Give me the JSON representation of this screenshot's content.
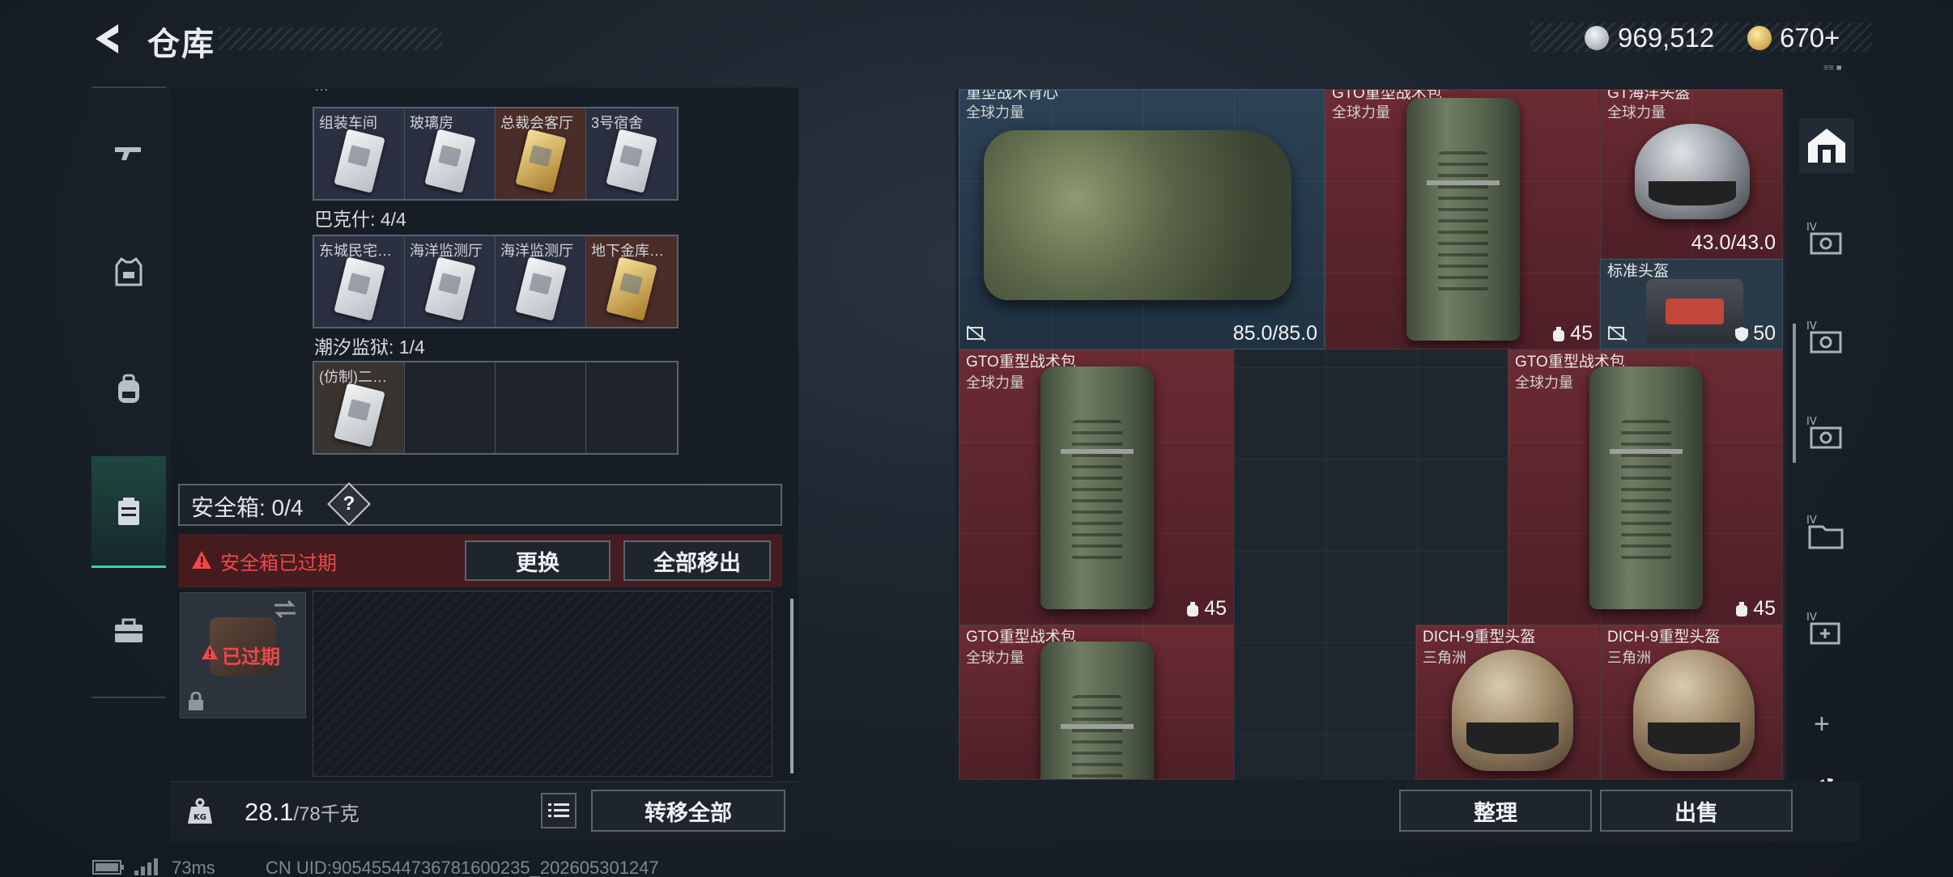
{
  "header": {
    "title": "仓库",
    "currency_silver": "969,512",
    "currency_gold": "670+",
    "usage_hint": "≡≡ ■"
  },
  "left_nav": {
    "items": [
      {
        "name": "weapons",
        "icon": "gun-icon"
      },
      {
        "name": "armor",
        "icon": "armor-vest-icon"
      },
      {
        "name": "backpack",
        "icon": "backpack-icon"
      },
      {
        "name": "container",
        "icon": "container-icon",
        "active": true
      },
      {
        "name": "toolbox",
        "icon": "toolbox-icon"
      }
    ]
  },
  "keys": {
    "top_label_partial": "…",
    "row1": [
      {
        "name": "组装车间",
        "rarity": "white"
      },
      {
        "name": "玻璃房",
        "rarity": "white"
      },
      {
        "name": "总裁会客厅",
        "rarity": "gold"
      },
      {
        "name": "3号宿舍",
        "rarity": "white"
      }
    ],
    "group2_label": "巴克什: 4/4",
    "row2": [
      {
        "name": "东城民宅…",
        "rarity": "white"
      },
      {
        "name": "海洋监测厅",
        "rarity": "white"
      },
      {
        "name": "海洋监测厅",
        "rarity": "white"
      },
      {
        "name": "地下金库…",
        "rarity": "gold"
      }
    ],
    "group3_label": "潮汐监狱: 1/4",
    "row3": [
      {
        "name": "(仿制)二…",
        "rarity": "white"
      }
    ]
  },
  "safebox": {
    "title": "安全箱: 0/4",
    "help": "?",
    "expired_warning": "安全箱已过期",
    "replace_button": "更换",
    "move_all_button": "全部移出",
    "item_expired_label": "已过期"
  },
  "weight": {
    "current": "28.1",
    "max": "/78千克",
    "transfer_all_button": "转移全部",
    "kg_label": "KG"
  },
  "stash_items": [
    {
      "id": "vest",
      "name": "重型战术背心",
      "sub": "全球力量",
      "value": "85.0/85.0"
    },
    {
      "id": "pack-top",
      "name": "GTO重型战术包",
      "sub": "全球力量",
      "capacity": "45"
    },
    {
      "id": "helmet-top",
      "name": "GT海洋头盔",
      "sub": "全球力量",
      "value": "43.0/43.0"
    },
    {
      "id": "std-helmet",
      "name": "标准头盔",
      "sub": "",
      "armor": "50"
    },
    {
      "id": "pack-2",
      "name": "GTO重型战术包",
      "sub": "全球力量",
      "capacity": "45"
    },
    {
      "id": "pack-3",
      "name": "GTO重型战术包",
      "sub": "全球力量",
      "capacity": "45"
    },
    {
      "id": "pack-4",
      "name": "GTO重型战术包",
      "sub": "全球力量"
    },
    {
      "id": "dich-1",
      "name": "DICH-9重型头盔",
      "sub": "三角洲"
    },
    {
      "id": "dich-2",
      "name": "DICH-9重型头盔",
      "sub": "三角洲"
    }
  ],
  "right_nav": {
    "tabs": [
      "IV",
      "IV",
      "IV",
      "IV",
      "IV"
    ],
    "add": "+"
  },
  "bottom_right": {
    "sort_button": "整理",
    "sell_button": "出售"
  },
  "footer": {
    "ping": "73ms",
    "uid": "CN UID:90545544736781600235_202605301247"
  }
}
